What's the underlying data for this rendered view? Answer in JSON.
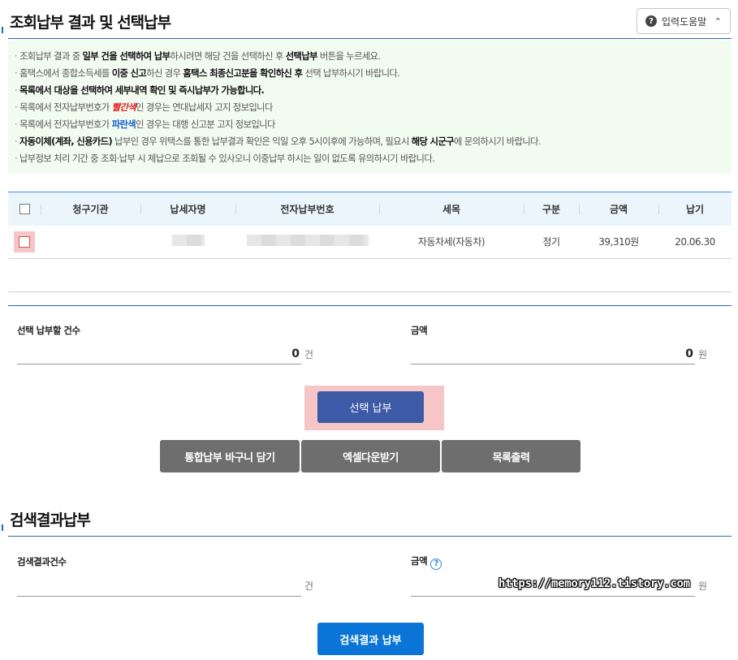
{
  "section1": {
    "title": "조회납부 결과 및 선택납부"
  },
  "help": {
    "label": "입력도움말"
  },
  "notice": {
    "n1": {
      "a": "조회납부 결과 중 ",
      "b": "일부 건을 선택하여 납부",
      "c": "하시려면 해당 건을 선택하신 후 ",
      "d": "선택납부",
      "e": " 버튼을 누르세요."
    },
    "n2": {
      "a": "홈택스에서 종합소득세를 ",
      "b": "이중 신고",
      "c": "하신 경우 ",
      "d": "홈택스 최종신고분을 확인하신 후",
      "e": " 선택 납부하시기 바랍니다."
    },
    "n3": {
      "a": "목록에서 대상을 선택하여 세부내역 확인 및 즉시납부가 가능합니다."
    },
    "n4": {
      "a": "목록에서 전자납부번호가 ",
      "b": "빨간색",
      "c": "인 경우는 연대납세자 고지 정보입니다"
    },
    "n5": {
      "a": "목록에서 전자납부번호가 ",
      "b": "파란색",
      "c": "인 경우는 대행 신고분 고지 정보입니다"
    },
    "n6": {
      "a": "자동이체(계좌, 신용카드)",
      "b": " 납부인 경우 위택스를 통한 납부결과 확인은 익일 오후 5시이후에 가능하며, 필요시 ",
      "c": "해당 시군구",
      "d": "에 문의하시기 바랍니다."
    },
    "n7": {
      "a": "납부정보 처리 기간 중 조회·납부 시 체납으로 조회될 수 있사오니 이중납부 하시는 일이 없도록 유의하시기 바랍니다."
    }
  },
  "table": {
    "headers": [
      "청구기관",
      "납세자명",
      "전자납부번호",
      "세목",
      "구분",
      "금액",
      "납기"
    ],
    "row": {
      "tax_item": "자동차세(자동차)",
      "type": "정기",
      "amount": "39,310원",
      "due": "20.06.30"
    }
  },
  "selection": {
    "count_label": "선택 납부할 건수",
    "count_value": "0",
    "count_unit": "건",
    "amount_label": "금액",
    "amount_value": "0",
    "amount_unit": "원"
  },
  "buttons": {
    "select_pay": "선택 납부",
    "basket": "통합납부 바구니 담기",
    "excel": "엑셀다운받기",
    "print": "목록출력",
    "search_pay": "검색결과 납부"
  },
  "section2": {
    "title": "검색결과납부",
    "count_label": "검색결과건수",
    "count_unit": "건",
    "amount_label": "금액",
    "amount_unit": "원"
  },
  "watermark": "https://memory112.tistory.com",
  "colors": {
    "accent": "#2b6cb0",
    "primary_button": "#3c5aa6",
    "blue_button": "#0a75d6",
    "highlight": "#f6c6c6",
    "notice_bg": "#f2fbf0"
  }
}
